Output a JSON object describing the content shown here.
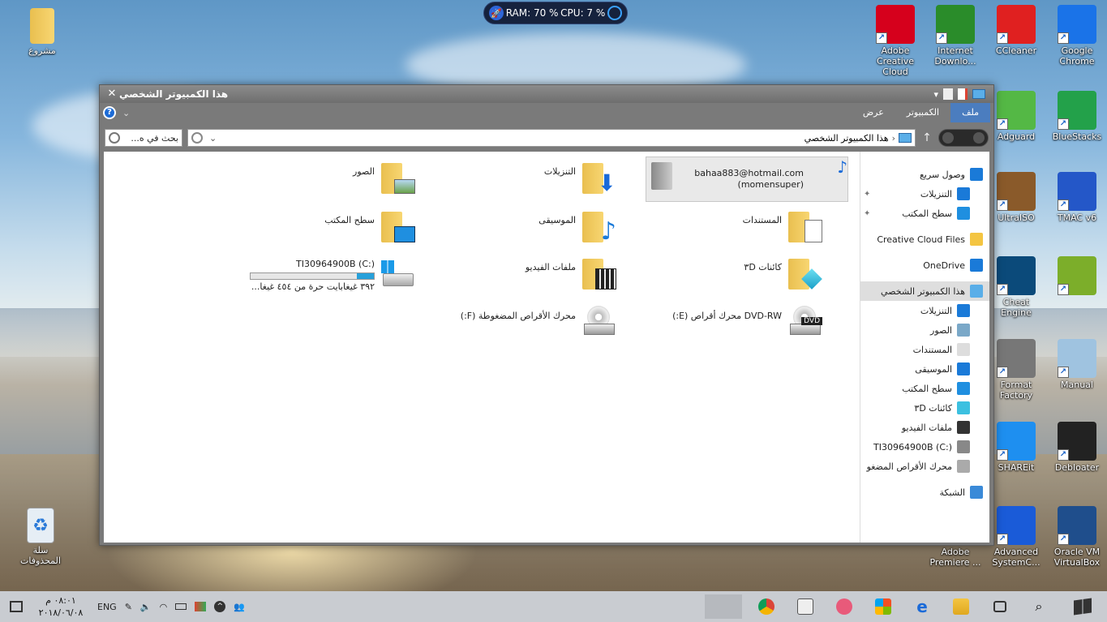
{
  "sysmon": {
    "ram": "RAM: 70 %",
    "cpu": "CPU: 7 %"
  },
  "desktop": {
    "left": [
      {
        "label": "مشروع",
        "icon": "folder-icon"
      },
      {
        "label": "سلة المحذوفات",
        "icon": "recycle-bin-icon"
      }
    ],
    "right": [
      {
        "label": "Adobe Creative Cloud",
        "icon": "adobe-cc-icon",
        "color": "#d6001c"
      },
      {
        "label": "Internet Downlo...",
        "icon": "idm-icon",
        "color": "#2a8c2a"
      },
      {
        "label": "CCleaner",
        "icon": "ccleaner-icon",
        "color": "#e02020"
      },
      {
        "label": "Google Chrome",
        "icon": "chrome-icon",
        "color": "#1a73e8"
      },
      {
        "label": "Adguard",
        "icon": "adguard-icon",
        "color": "#54b845"
      },
      {
        "label": "BlueStacks",
        "icon": "bluestacks-icon",
        "color": "#23a14a"
      },
      {
        "label": "UltraISO",
        "icon": "ultraiso-icon",
        "color": "#8a5a2a"
      },
      {
        "label": "TMAC v6",
        "icon": "tmac-icon",
        "color": "#2457c8"
      },
      {
        "label": "Cheat Engine",
        "icon": "cheat-engine-icon",
        "color": "#0b4a7a"
      },
      {
        "label": "",
        "icon": "music-shortcut-icon",
        "color": "#7cae2a"
      },
      {
        "label": "Format Factory",
        "icon": "format-factory-icon",
        "color": "#777777"
      },
      {
        "label": "Manual",
        "icon": "manual-icon",
        "color": "#9fc3e0"
      },
      {
        "label": "SHAREit",
        "icon": "shareit-icon",
        "color": "#1e8ff0"
      },
      {
        "label": "Debloater",
        "icon": "debloater-icon",
        "color": "#222222"
      },
      {
        "label": "Adobe Premiere ...",
        "icon": "premiere-icon",
        "color": "#2a1a4a"
      },
      {
        "label": "Advanced SystemC...",
        "icon": "advanced-systemcare-icon",
        "color": "#1a5bd8"
      },
      {
        "label": "Oracle VM VirtualBox",
        "icon": "virtualbox-icon",
        "color": "#1f4e8c"
      }
    ]
  },
  "window": {
    "title": "هذا الكمبيوتر الشخصي",
    "tabs": [
      "ملف",
      "الكمبيوتر",
      "عرض"
    ],
    "address": "هذا الكمبيوتر الشخصي",
    "search_placeholder": "بحث في ه...",
    "nav": [
      {
        "label": "وصول سريع",
        "icon": "star-icon",
        "pinned": false
      },
      {
        "label": "التنزيلات",
        "icon": "download-icon",
        "pinned": true
      },
      {
        "label": "سطح المكتب",
        "icon": "desktop-icon",
        "pinned": true
      },
      {
        "label": "Creative Cloud Files",
        "icon": "creative-cloud-icon",
        "pinned": false
      },
      {
        "label": "OneDrive",
        "icon": "onedrive-icon",
        "pinned": false
      },
      {
        "label": "هذا الكمبيوتر الشخصي",
        "icon": "computer-icon",
        "pinned": false
      },
      {
        "label": "التنزيلات",
        "icon": "download-icon",
        "pinned": false
      },
      {
        "label": "الصور",
        "icon": "pictures-icon",
        "pinned": false
      },
      {
        "label": "المستندات",
        "icon": "documents-icon",
        "pinned": false
      },
      {
        "label": "الموسيقى",
        "icon": "music-icon",
        "pinned": false
      },
      {
        "label": "سطح المكتب",
        "icon": "desktop-icon",
        "pinned": false
      },
      {
        "label": "كائنات ٣D",
        "icon": "3d-objects-icon",
        "pinned": false
      },
      {
        "label": "ملفات الفيديو",
        "icon": "videos-icon",
        "pinned": false
      },
      {
        "label": "TI30964900B (C:)",
        "icon": "drive-icon",
        "pinned": false
      },
      {
        "label": "محرك الأقراص المضغو",
        "icon": "cd-drive-icon",
        "pinned": false
      },
      {
        "label": "الشبكة",
        "icon": "network-icon",
        "pinned": false
      }
    ],
    "user": {
      "email": "bahaa883@hotmail.com",
      "name": "(momensuper)"
    },
    "folders": [
      {
        "label": "التنزيلات",
        "icon": "download-folder-icon"
      },
      {
        "label": "الصور",
        "icon": "pictures-folder-icon"
      },
      {
        "label": "المستندات",
        "icon": "documents-folder-icon"
      },
      {
        "label": "الموسيقى",
        "icon": "music-folder-icon"
      },
      {
        "label": "سطح المكتب",
        "icon": "desktop-folder-icon"
      },
      {
        "label": "كائنات ٣D",
        "icon": "3d-objects-folder-icon"
      },
      {
        "label": "ملفات الفيديو",
        "icon": "videos-folder-icon"
      }
    ],
    "drives": [
      {
        "label": "TI30964900B (C:)",
        "detail": "٣٩٢ غيغابايت حرة من ٤٥٤ غيغا...",
        "used_fraction": 0.14,
        "icon": "windows-drive-icon"
      },
      {
        "label": "DVD-RW محرك أقراص (E:)",
        "icon": "dvd-drive-icon",
        "badge": "DVD"
      },
      {
        "label": "محرك الأقراص المضغوطة (F:)",
        "icon": "cd-drive-icon"
      }
    ]
  },
  "taskbar": {
    "time": "٠٨:٠١ م",
    "date": "٢٠١٨/٠٦/٠٨",
    "lang": "ENG"
  }
}
